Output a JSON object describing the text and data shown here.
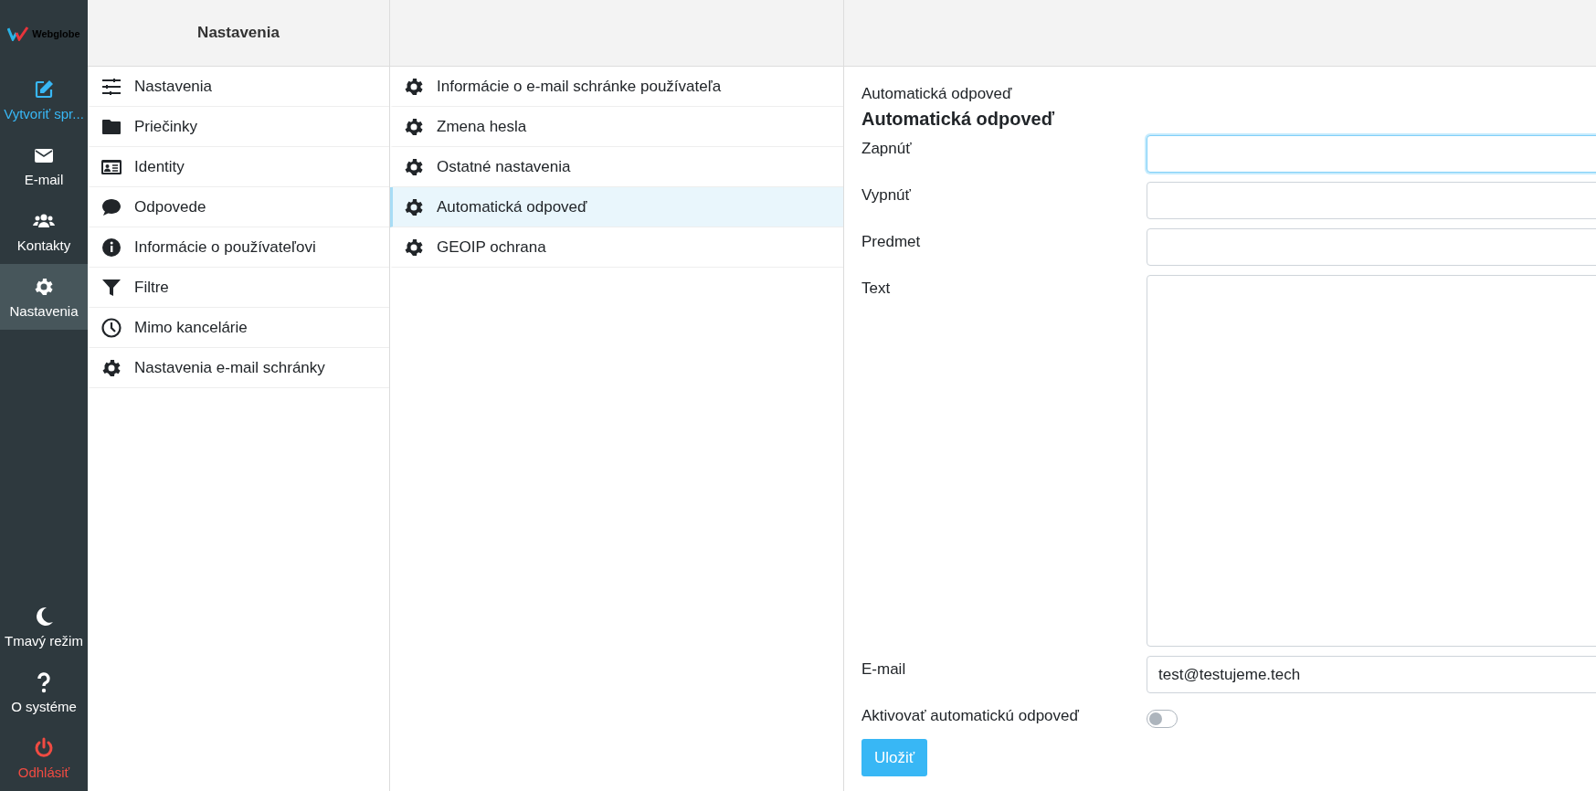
{
  "sidebar": {
    "logo": "Webglobe",
    "top_items": [
      {
        "label": "Vytvoriť spr...",
        "kind": "accent",
        "selected": false
      },
      {
        "label": "E-mail",
        "kind": "normal",
        "selected": false
      },
      {
        "label": "Kontakty",
        "kind": "normal",
        "selected": false
      },
      {
        "label": "Nastavenia",
        "kind": "normal",
        "selected": true
      }
    ],
    "bottom_items": [
      {
        "label": "Tmavý režim",
        "kind": "normal",
        "selected": false
      },
      {
        "label": "O systéme",
        "kind": "normal",
        "selected": false
      },
      {
        "label": "Odhlásiť",
        "kind": "danger",
        "selected": false
      }
    ]
  },
  "settings_column": {
    "title": "Nastavenia",
    "items": [
      {
        "label": "Nastavenia",
        "selected": false
      },
      {
        "label": "Priečinky",
        "selected": false
      },
      {
        "label": "Identity",
        "selected": false
      },
      {
        "label": "Odpovede",
        "selected": false
      },
      {
        "label": "Informácie o používateľovi",
        "selected": false
      },
      {
        "label": "Filtre",
        "selected": false
      },
      {
        "label": "Mimo kancelárie",
        "selected": false
      },
      {
        "label": "Nastavenia e-mail schránky",
        "selected": false
      }
    ]
  },
  "section_column": {
    "items": [
      {
        "label": "Informácie o e-mail schránke používateľa",
        "selected": false
      },
      {
        "label": "Zmena hesla",
        "selected": false
      },
      {
        "label": "Ostatné nastavenia",
        "selected": false
      },
      {
        "label": "Automatická odpoveď",
        "selected": true
      },
      {
        "label": "GEOIP ochrana",
        "selected": false
      }
    ]
  },
  "form": {
    "breadcrumb": "Automatická odpoveď",
    "title": "Automatická odpoveď",
    "fields": [
      {
        "label": "Zapnúť",
        "kind": "input",
        "focused": true
      },
      {
        "label": "Vypnúť",
        "kind": "input",
        "focused": false
      },
      {
        "label": "Predmet",
        "kind": "input",
        "focused": false
      },
      {
        "label": "Text",
        "kind": "textarea",
        "focused": false
      },
      {
        "label": "E-mail",
        "kind": "input",
        "focused": false,
        "value": "test@testujeme.tech"
      }
    ],
    "toggle": {
      "label": "Aktivovať automatickú odpoveď",
      "on": false
    },
    "save_button": "Uložiť"
  }
}
